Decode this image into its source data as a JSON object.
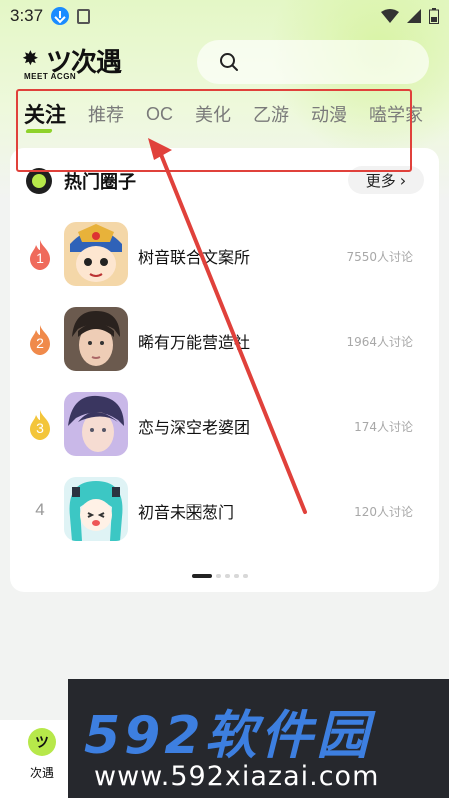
{
  "status_bar": {
    "time": "3:37"
  },
  "app": {
    "logo_text": "ツ次遇",
    "logo_subtext": "MEET ACGN",
    "search_icon": "search-icon"
  },
  "tabs": [
    {
      "label": "关注",
      "active": true
    },
    {
      "label": "推荐"
    },
    {
      "label": "OC"
    },
    {
      "label": "美化"
    },
    {
      "label": "乙游"
    },
    {
      "label": "动漫"
    },
    {
      "label": "嗑学家"
    }
  ],
  "hot_circles": {
    "title": "热门圈子",
    "more_label": "更多",
    "rows": [
      {
        "rank": "1",
        "name": "树音联合文案所",
        "count": "7550人讨论"
      },
      {
        "rank": "2",
        "name": "晞有万能营造社",
        "count": "1964人讨论"
      },
      {
        "rank": "3",
        "name": "恋与深空老婆团",
        "count": "174人讨论"
      },
      {
        "rank": "4",
        "name": "初音未来⃞葱门",
        "count": "120人讨论"
      }
    ]
  },
  "bottom_nav": {
    "home_label": "次遇"
  },
  "watermark": {
    "main": "592软件园",
    "sub": "www.592xiazai.com"
  },
  "colors": {
    "accent": "#8ed22a",
    "annotation": "#e0413b",
    "rank1": "#ef6a5b",
    "rank2": "#f08a4b",
    "rank3": "#f3c53a"
  }
}
